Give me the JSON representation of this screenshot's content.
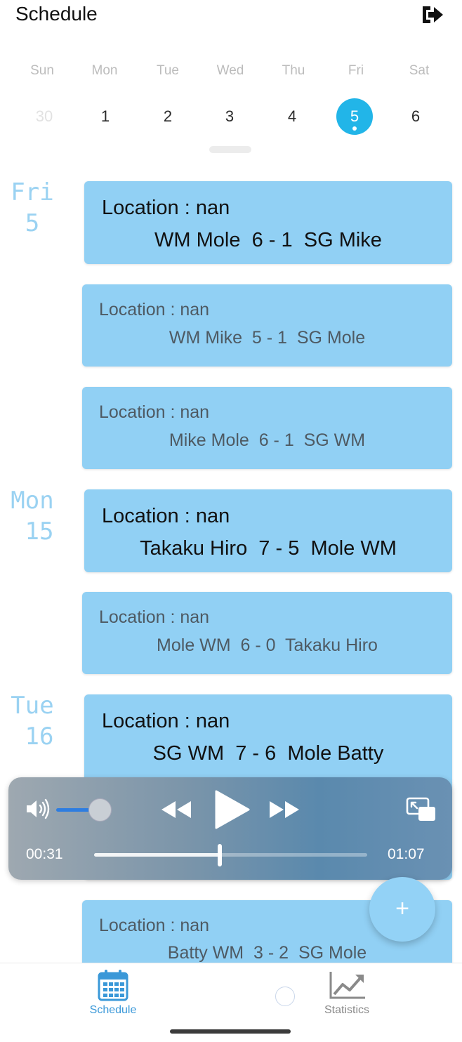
{
  "header": {
    "title": "Schedule",
    "exit_icon": "exit-icon"
  },
  "week": {
    "days": [
      {
        "name": "Sun",
        "num": "30",
        "state": "dim"
      },
      {
        "name": "Mon",
        "num": "1",
        "state": "normal"
      },
      {
        "name": "Tue",
        "num": "2",
        "state": "normal"
      },
      {
        "name": "Wed",
        "num": "3",
        "state": "normal"
      },
      {
        "name": "Thu",
        "num": "4",
        "state": "normal"
      },
      {
        "name": "Fri",
        "num": "5",
        "state": "selected"
      },
      {
        "name": "Sat",
        "num": "6",
        "state": "normal"
      }
    ],
    "accent": "#22b5e8"
  },
  "agenda": {
    "groups": [
      {
        "weekday": "Fri",
        "day": "5"
      },
      {
        "weekday": "Mon",
        "day": "15"
      },
      {
        "weekday": "Tue",
        "day": "16"
      }
    ],
    "cards": [
      {
        "location": "Location : nan",
        "match": "WM Mole  6 - 1  SG Mike"
      },
      {
        "location": "Location : nan",
        "match": "WM Mike  5 - 1  SG Mole"
      },
      {
        "location": "Location : nan",
        "match": "Mike Mole  6 - 1  SG WM"
      },
      {
        "location": "Location : nan",
        "match": "Takaku Hiro  7 - 5  Mole WM"
      },
      {
        "location": "Location : nan",
        "match": "Mole WM  6 - 0  Takaku Hiro"
      },
      {
        "location": "Location : nan",
        "match": "SG WM  7 - 6  Mole Batty"
      },
      {
        "location": "Location : nan",
        "match": "Batty WM  3 - 2  SG Mole"
      }
    ],
    "card_color": "#91d0f4",
    "date_color": "#9ad2f2"
  },
  "player": {
    "current_time": "00:31",
    "total_time": "01:07",
    "progress": 0.46,
    "volume": 0.55,
    "icons": [
      "volume-icon",
      "rewind-icon",
      "play-icon",
      "fast-forward-icon",
      "picture-in-picture-icon"
    ]
  },
  "fab": {
    "label": "+"
  },
  "bottom_nav": {
    "schedule_label": "Schedule",
    "statistics_label": "Statistics",
    "active": "Schedule"
  }
}
